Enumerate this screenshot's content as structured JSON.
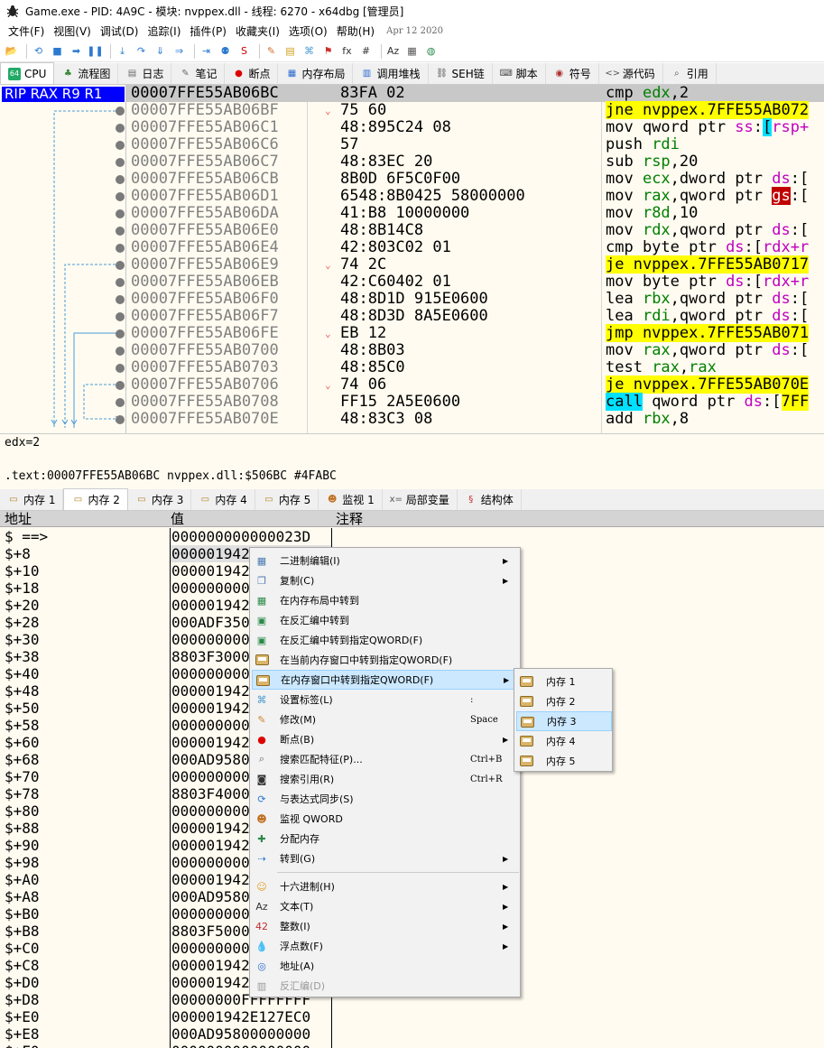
{
  "titlebar": {
    "title": "Game.exe - PID: 4A9C - 模块: nvppex.dll - 线程: 6270 - x64dbg [管理员]"
  },
  "menubar": {
    "items": [
      "文件(F)",
      "视图(V)",
      "调试(D)",
      "追踪(I)",
      "插件(P)",
      "收藏夹(I)",
      "选项(O)",
      "帮助(H)"
    ],
    "date": "Apr 12 2020"
  },
  "toolbar": {
    "icons": [
      "open-icon",
      "restart-icon",
      "stop-icon",
      "run-icon",
      "pause-icon",
      "step-into-icon",
      "step-over-icon",
      "trace-into-icon",
      "trace-over-icon",
      "execute-till-return-icon",
      "run-to-user-code-icon",
      "scylla-icon",
      "patch-icon",
      "comment-icon",
      "label-icon",
      "bookmark-icon",
      "function-icon",
      "hash-icon",
      "strings-icon",
      "calculator-icon",
      "globe-icon"
    ]
  },
  "tabs1": [
    {
      "label": "CPU",
      "icon": "cpu-icon",
      "active": true
    },
    {
      "label": "流程图",
      "icon": "graph-icon"
    },
    {
      "label": "日志",
      "icon": "log-icon"
    },
    {
      "label": "笔记",
      "icon": "notes-icon"
    },
    {
      "label": "断点",
      "icon": "breakpoint-icon"
    },
    {
      "label": "内存布局",
      "icon": "memory-map-icon"
    },
    {
      "label": "调用堆栈",
      "icon": "callstack-icon"
    },
    {
      "label": "SEH链",
      "icon": "seh-icon"
    },
    {
      "label": "脚本",
      "icon": "script-icon"
    },
    {
      "label": "符号",
      "icon": "symbol-icon"
    },
    {
      "label": "源代码",
      "icon": "source-icon"
    },
    {
      "label": "引用",
      "icon": "reference-icon"
    }
  ],
  "cpu": {
    "regbar": "RIP RAX R9 R1",
    "rows": [
      {
        "addr": "00007FFE55AB06BC",
        "arrow": "",
        "bytes": "83FA 02",
        "ins": [
          [
            "cmp ",
            ""
          ],
          [
            "edx",
            "reg"
          ],
          [
            ",2",
            ""
          ]
        ],
        "sel": true
      },
      {
        "addr": "00007FFE55AB06BF",
        "arrow": "⌄",
        "bytes": "75 60",
        "ins": [
          [
            "jne nvppex.7FFE55AB072",
            "hl-y"
          ]
        ]
      },
      {
        "addr": "00007FFE55AB06C1",
        "arrow": "",
        "bytes": "48:895C24 08",
        "ins": [
          [
            "mov qword ptr ",
            ""
          ],
          [
            "ss",
            "seg"
          ],
          [
            ":",
            ""
          ],
          [
            "[",
            "hl-c"
          ],
          [
            "rsp+",
            "seg"
          ]
        ]
      },
      {
        "addr": "00007FFE55AB06C6",
        "arrow": "",
        "bytes": "57",
        "ins": [
          [
            "push ",
            ""
          ],
          [
            "rdi",
            "reg"
          ]
        ]
      },
      {
        "addr": "00007FFE55AB06C7",
        "arrow": "",
        "bytes": "48:83EC 20",
        "ins": [
          [
            "sub ",
            ""
          ],
          [
            "rsp",
            "reg"
          ],
          [
            ",20",
            ""
          ]
        ]
      },
      {
        "addr": "00007FFE55AB06CB",
        "arrow": "",
        "bytes": "8B0D 6F5C0F00",
        "ins": [
          [
            "mov ",
            ""
          ],
          [
            "ecx",
            "reg"
          ],
          [
            ",dword ptr ",
            ""
          ],
          [
            "ds",
            "seg"
          ],
          [
            ":[",
            ""
          ]
        ]
      },
      {
        "addr": "00007FFE55AB06D1",
        "arrow": "",
        "bytes": "6548:8B0425 58000000",
        "ins": [
          [
            "mov ",
            ""
          ],
          [
            "rax",
            "reg"
          ],
          [
            ",qword ptr ",
            ""
          ],
          [
            "gs",
            "hl-r"
          ],
          [
            ":[",
            ""
          ]
        ]
      },
      {
        "addr": "00007FFE55AB06DA",
        "arrow": "",
        "bytes": "41:B8 10000000",
        "ins": [
          [
            "mov ",
            ""
          ],
          [
            "r8d",
            "reg"
          ],
          [
            ",10",
            ""
          ]
        ]
      },
      {
        "addr": "00007FFE55AB06E0",
        "arrow": "",
        "bytes": "48:8B14C8",
        "ins": [
          [
            "mov ",
            ""
          ],
          [
            "rdx",
            "reg"
          ],
          [
            ",qword ptr ",
            ""
          ],
          [
            "ds",
            "seg"
          ],
          [
            ":[",
            ""
          ]
        ]
      },
      {
        "addr": "00007FFE55AB06E4",
        "arrow": "",
        "bytes": "42:803C02 01",
        "ins": [
          [
            "cmp byte ptr ",
            ""
          ],
          [
            "ds",
            "seg"
          ],
          [
            ":[",
            ""
          ],
          [
            "rdx+r",
            "seg"
          ]
        ]
      },
      {
        "addr": "00007FFE55AB06E9",
        "arrow": "⌄",
        "bytes": "74 2C",
        "ins": [
          [
            "je nvppex.7FFE55AB0717",
            "hl-y"
          ]
        ]
      },
      {
        "addr": "00007FFE55AB06EB",
        "arrow": "",
        "bytes": "42:C60402 01",
        "ins": [
          [
            "mov byte ptr ",
            ""
          ],
          [
            "ds",
            "seg"
          ],
          [
            ":[",
            ""
          ],
          [
            "rdx+r",
            "seg"
          ]
        ]
      },
      {
        "addr": "00007FFE55AB06F0",
        "arrow": "",
        "bytes": "48:8D1D 915E0600",
        "ins": [
          [
            "lea ",
            ""
          ],
          [
            "rbx",
            "reg"
          ],
          [
            ",qword ptr ",
            ""
          ],
          [
            "ds",
            "seg"
          ],
          [
            ":[",
            ""
          ]
        ]
      },
      {
        "addr": "00007FFE55AB06F7",
        "arrow": "",
        "bytes": "48:8D3D 8A5E0600",
        "ins": [
          [
            "lea ",
            ""
          ],
          [
            "rdi",
            "reg"
          ],
          [
            ",qword ptr ",
            ""
          ],
          [
            "ds",
            "seg"
          ],
          [
            ":[",
            ""
          ]
        ]
      },
      {
        "addr": "00007FFE55AB06FE",
        "arrow": "⌄",
        "bytes": "EB 12",
        "ins": [
          [
            "jmp nvppex.7FFE55AB071",
            "hl-y"
          ]
        ]
      },
      {
        "addr": "00007FFE55AB0700",
        "arrow": "",
        "bytes": "48:8B03",
        "ins": [
          [
            "mov ",
            ""
          ],
          [
            "rax",
            "reg"
          ],
          [
            ",qword ptr ",
            ""
          ],
          [
            "ds",
            "seg"
          ],
          [
            ":[",
            ""
          ]
        ]
      },
      {
        "addr": "00007FFE55AB0703",
        "arrow": "",
        "bytes": "48:85C0",
        "ins": [
          [
            "test ",
            ""
          ],
          [
            "rax",
            "reg"
          ],
          [
            ",",
            ""
          ],
          [
            "rax",
            "reg"
          ]
        ]
      },
      {
        "addr": "00007FFE55AB0706",
        "arrow": "⌄",
        "bytes": "74 06",
        "ins": [
          [
            "je nvppex.7FFE55AB070E",
            "hl-y"
          ]
        ]
      },
      {
        "addr": "00007FFE55AB0708",
        "arrow": "",
        "bytes": "FF15 2A5E0600",
        "ins": [
          [
            "call",
            "hl-c"
          ],
          [
            " qword ptr ",
            ""
          ],
          [
            "ds",
            "seg"
          ],
          [
            ":[",
            ""
          ],
          [
            "7FF",
            "hl-y"
          ]
        ]
      },
      {
        "addr": "00007FFE55AB070E",
        "arrow": "",
        "bytes": "48:83C3 08",
        "ins": [
          [
            "add ",
            ""
          ],
          [
            "rbx",
            "reg"
          ],
          [
            ",8",
            ""
          ]
        ]
      }
    ]
  },
  "info": {
    "line1": "edx=2",
    "line2": ".text:00007FFE55AB06BC nvppex.dll:$506BC #4FABC"
  },
  "tabs2": [
    {
      "label": "内存 1",
      "icon": "memory-icon"
    },
    {
      "label": "内存 2",
      "icon": "memory-icon",
      "active": true
    },
    {
      "label": "内存 3",
      "icon": "memory-icon"
    },
    {
      "label": "内存 4",
      "icon": "memory-icon"
    },
    {
      "label": "内存 5",
      "icon": "memory-icon"
    },
    {
      "label": "监视 1",
      "icon": "watch-icon"
    },
    {
      "label": "局部变量",
      "icon": "locals-icon"
    },
    {
      "label": "结构体",
      "icon": "struct-icon"
    }
  ],
  "dump": {
    "headers": {
      "addr": "地址",
      "value": "值",
      "comment": "注释"
    },
    "rows": [
      {
        "a": "$ ==>",
        "v": "000000000000023D"
      },
      {
        "a": "$+8",
        "v": "0000019420128E0",
        "sel": true
      },
      {
        "a": "$+10",
        "v": "0000019420128E0"
      },
      {
        "a": "$+18",
        "v": "000000000000000"
      },
      {
        "a": "$+20",
        "v": "0000019420128E0"
      },
      {
        "a": "$+28",
        "v": "000ADF350000000"
      },
      {
        "a": "$+30",
        "v": "000000000000000"
      },
      {
        "a": "$+38",
        "v": "8803F3000000000"
      },
      {
        "a": "$+40",
        "v": "000000000000000"
      },
      {
        "a": "$+48",
        "v": "0000019420128E0"
      },
      {
        "a": "$+50",
        "v": "0000019420128E0"
      },
      {
        "a": "$+58",
        "v": "000000000000000"
      },
      {
        "a": "$+60",
        "v": "0000019420128E0"
      },
      {
        "a": "$+68",
        "v": "000AD9580000000"
      },
      {
        "a": "$+70",
        "v": "000000000000000"
      },
      {
        "a": "$+78",
        "v": "8803F4000000000"
      },
      {
        "a": "$+80",
        "v": "000000000000000"
      },
      {
        "a": "$+88",
        "v": "0000019420128E0"
      },
      {
        "a": "$+90",
        "v": "0000019420128E0"
      },
      {
        "a": "$+98",
        "v": "000000000000000"
      },
      {
        "a": "$+A0",
        "v": "0000019420128E0"
      },
      {
        "a": "$+A8",
        "v": "000AD9580000000"
      },
      {
        "a": "$+B0",
        "v": "000000000000000"
      },
      {
        "a": "$+B8",
        "v": "8803F5000000000"
      },
      {
        "a": "$+C0",
        "v": "000000000000000"
      },
      {
        "a": "$+C8",
        "v": "0000019420128E0"
      },
      {
        "a": "$+D0",
        "v": "0000019420128E0"
      },
      {
        "a": "$+D8",
        "v": "00000000FFFFFFFF"
      },
      {
        "a": "$+E0",
        "v": "000001942E127EC0"
      },
      {
        "a": "$+E8",
        "v": "000AD95800000000"
      },
      {
        "a": "$+F0",
        "v": "0000000000000000"
      }
    ]
  },
  "ctxmenu": [
    {
      "label": "二进制编辑(I)",
      "icon": "binary-edit-icon",
      "arrow": true
    },
    {
      "label": "复制(C)",
      "icon": "copy-icon",
      "arrow": true
    },
    {
      "label": "在内存布局中转到",
      "icon": "memory-map-icon"
    },
    {
      "label": "在反汇编中转到",
      "icon": "disassembly-icon"
    },
    {
      "label": "在反汇编中转到指定QWORD(F)",
      "icon": "disassembly-qword-icon"
    },
    {
      "label": "在当前内存窗口中转到指定QWORD(F)",
      "icon": "memory-icon"
    },
    {
      "label": "在内存窗口中转到指定QWORD(F)",
      "icon": "memory-icon",
      "arrow": true,
      "hover": true
    },
    {
      "label": "设置标签(L)",
      "icon": "label-icon",
      "shortcut": ":"
    },
    {
      "label": "修改(M)",
      "icon": "pencil-icon",
      "shortcut": "Space"
    },
    {
      "label": "断点(B)",
      "icon": "breakpoint-icon",
      "arrow": true
    },
    {
      "label": "搜索匹配特征(P)...",
      "icon": "search-pattern-icon",
      "shortcut": "Ctrl+B"
    },
    {
      "label": "搜索引用(R)",
      "icon": "binoculars-icon",
      "shortcut": "Ctrl+R"
    },
    {
      "label": "与表达式同步(S)",
      "icon": "sync-icon"
    },
    {
      "label": "监视 QWORD",
      "icon": "watch-icon"
    },
    {
      "label": "分配内存",
      "icon": "alloc-memory-icon"
    },
    {
      "label": "转到(G)",
      "icon": "goto-icon",
      "arrow": true
    },
    {
      "sep": true
    },
    {
      "label": "十六进制(H)",
      "icon": "hex-icon",
      "arrow": true
    },
    {
      "label": "文本(T)",
      "icon": "text-icon",
      "arrow": true
    },
    {
      "label": "整数(I)",
      "icon": "integer-icon",
      "arrow": true
    },
    {
      "label": "浮点数(F)",
      "icon": "float-icon",
      "arrow": true
    },
    {
      "label": "地址(A)",
      "icon": "address-icon"
    },
    {
      "label": "反汇编(D)",
      "icon": "disassemble-icon",
      "disabled": true
    }
  ],
  "submenu": [
    {
      "label": "内存 1"
    },
    {
      "label": "内存 2"
    },
    {
      "label": "内存 3",
      "hover": true
    },
    {
      "label": "内存 4"
    },
    {
      "label": "内存 5"
    }
  ]
}
